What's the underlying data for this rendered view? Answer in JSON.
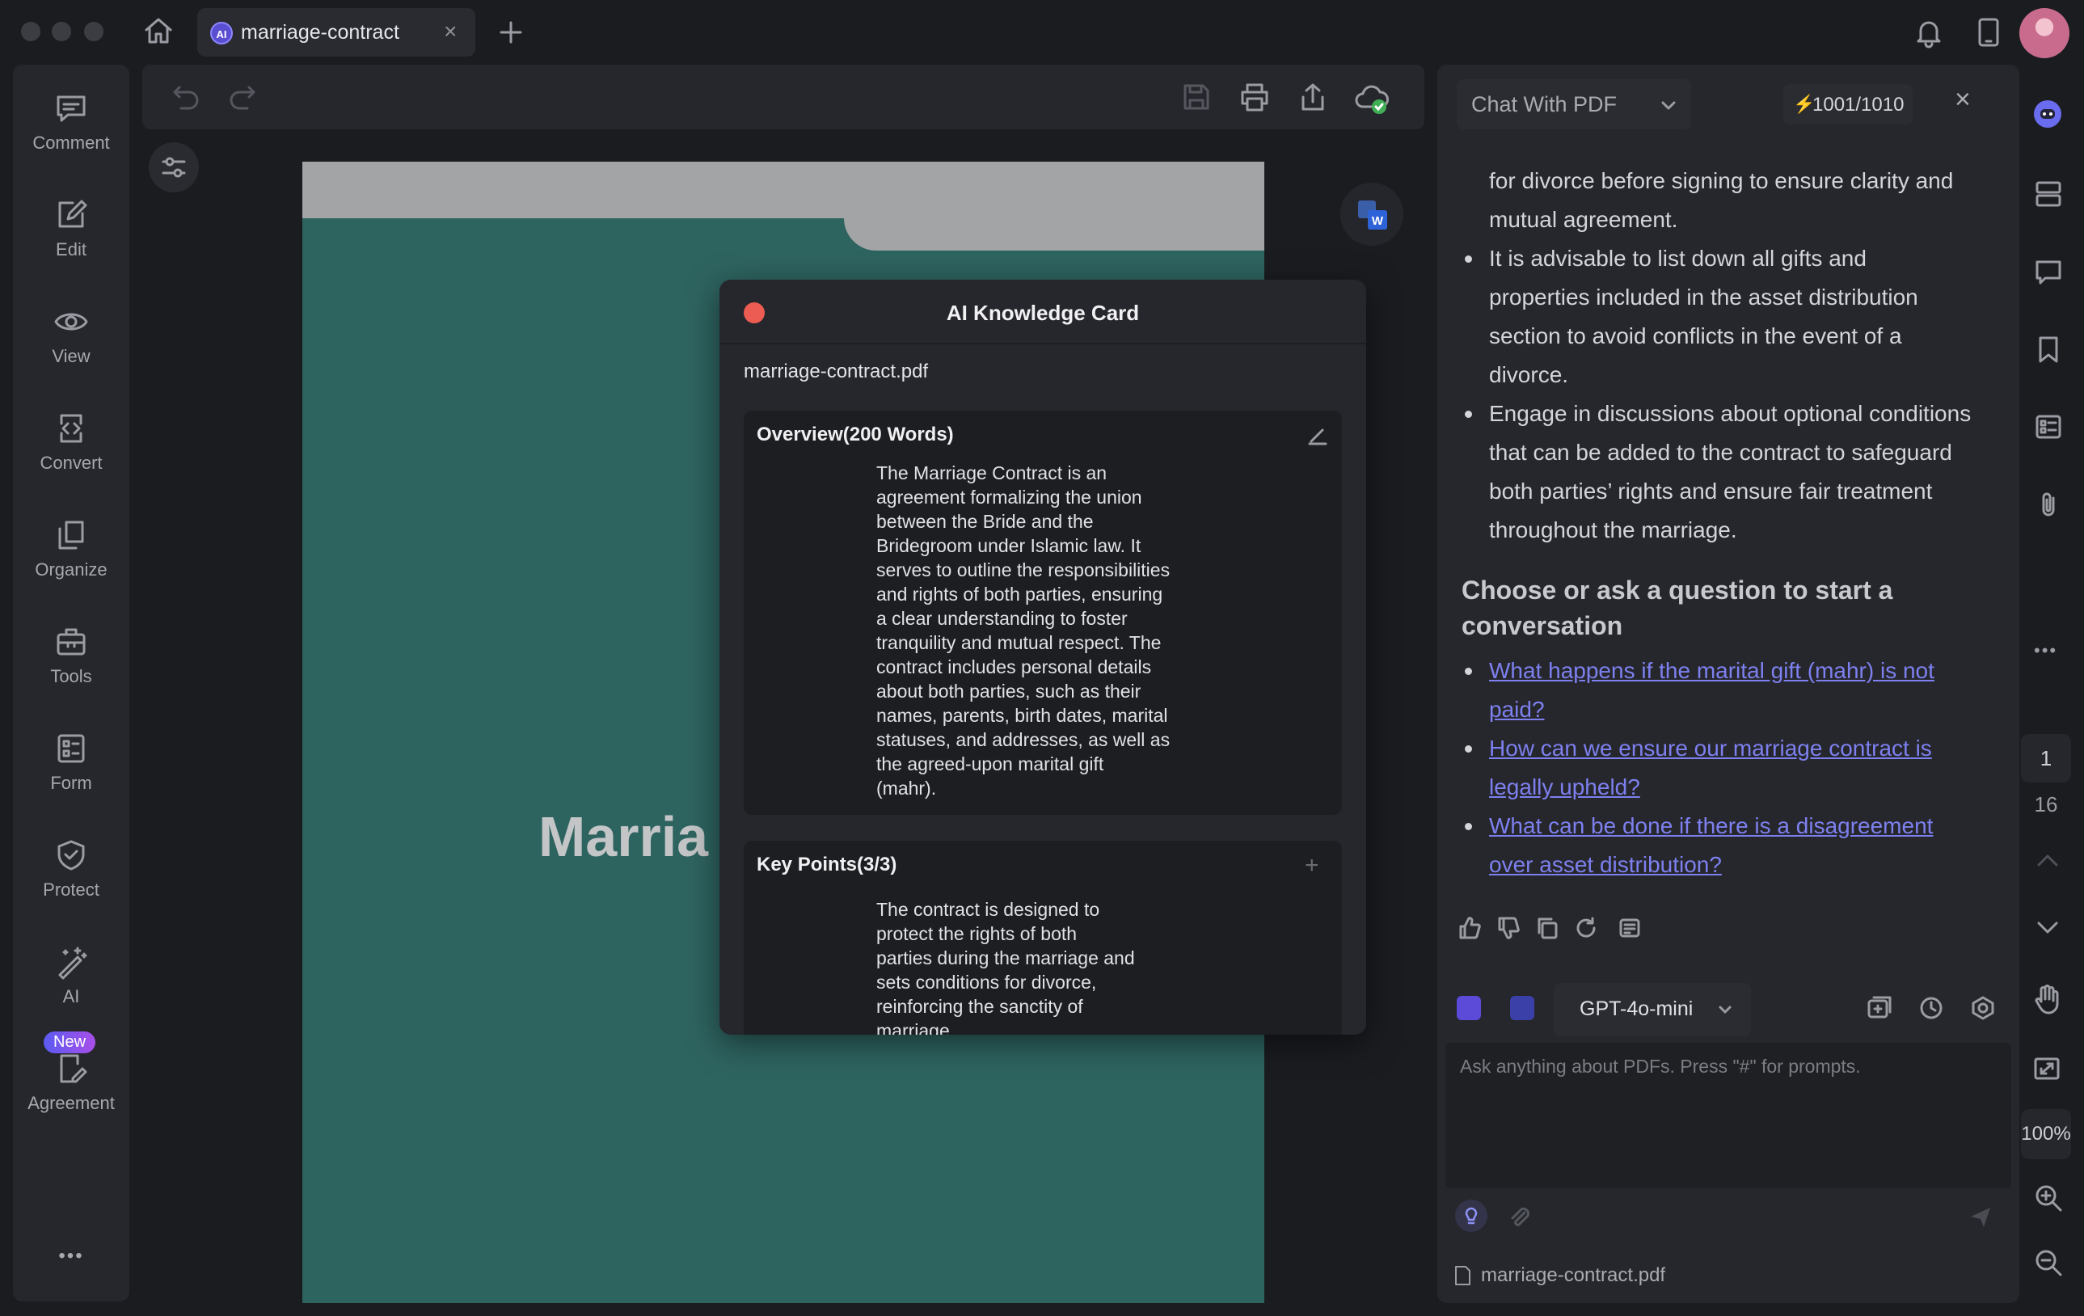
{
  "tab": {
    "badge": "AI",
    "title": "marriage-contract"
  },
  "sidebar": {
    "items": [
      {
        "label": "Comment",
        "icon": "comment-icon"
      },
      {
        "label": "Edit",
        "icon": "edit-icon"
      },
      {
        "label": "View",
        "icon": "eye-icon"
      },
      {
        "label": "Convert",
        "icon": "convert-icon"
      },
      {
        "label": "Organize",
        "icon": "organize-icon"
      },
      {
        "label": "Tools",
        "icon": "toolbox-icon"
      },
      {
        "label": "Form",
        "icon": "form-icon"
      },
      {
        "label": "Protect",
        "icon": "shield-icon"
      },
      {
        "label": "AI",
        "icon": "magic-wand-icon"
      },
      {
        "label": "Agreement",
        "icon": "agreement-icon"
      }
    ],
    "new_badge": "New",
    "more": "•••"
  },
  "document": {
    "title_fragment": "Marria"
  },
  "card": {
    "title": "AI Knowledge Card",
    "file": "marriage-contract.pdf",
    "overview": {
      "heading": "Overview(200 Words)",
      "lines": [
        "The Marriage Contract is an",
        "agreement formalizing the union",
        "between the Bride and the",
        "Bridegroom under Islamic law. It",
        "serves to outline the responsibilities",
        "and rights of both parties, ensuring",
        "a clear understanding to foster",
        "tranquility and mutual respect. The",
        "contract includes personal details",
        "about both parties, such as their",
        "names, parents, birth dates, marital",
        "statuses, and addresses, as well as",
        "the agreed-upon marital gift",
        "(mahr)."
      ]
    },
    "keypoints": {
      "heading": "Key Points(3/3)",
      "lines": [
        "The contract is designed to",
        "protect the rights of both",
        "parties during the marriage and",
        "sets conditions for divorce,",
        "reinforcing the sanctity of",
        "marriage."
      ]
    }
  },
  "chat": {
    "mode": "Chat With PDF",
    "credits": "1001/1010",
    "top_lines": [
      "for divorce before signing to ensure clarity and",
      "mutual agreement."
    ],
    "bullets": [
      [
        "It is advisable to list down all gifts and",
        "properties included in the asset distribution",
        "section to avoid conflicts in the event of a",
        "divorce."
      ],
      [
        "Engage in discussions about optional conditions",
        "that can be added to the contract to safeguard",
        "both parties’ rights and ensure fair treatment",
        "throughout the marriage."
      ]
    ],
    "heading": "Choose or ask a question to start a conversation",
    "questions": [
      [
        "What happens if the marital gift (mahr) is not",
        "paid?"
      ],
      [
        "How can we ensure our marriage contract is",
        "legally upheld?"
      ],
      [
        "What can be done if there is a disagreement",
        "over asset distribution?"
      ]
    ],
    "model": "GPT-4o-mini",
    "input_placeholder": "Ask anything about PDFs. Press \"#\" for prompts.",
    "file": "marriage-contract.pdf"
  },
  "rail": {
    "page": "1",
    "total": "16",
    "zoom": "100%"
  },
  "colors": {
    "accent": "#7d80ee",
    "doc_cover": "#2e6460",
    "close_red": "#ec5c52"
  }
}
